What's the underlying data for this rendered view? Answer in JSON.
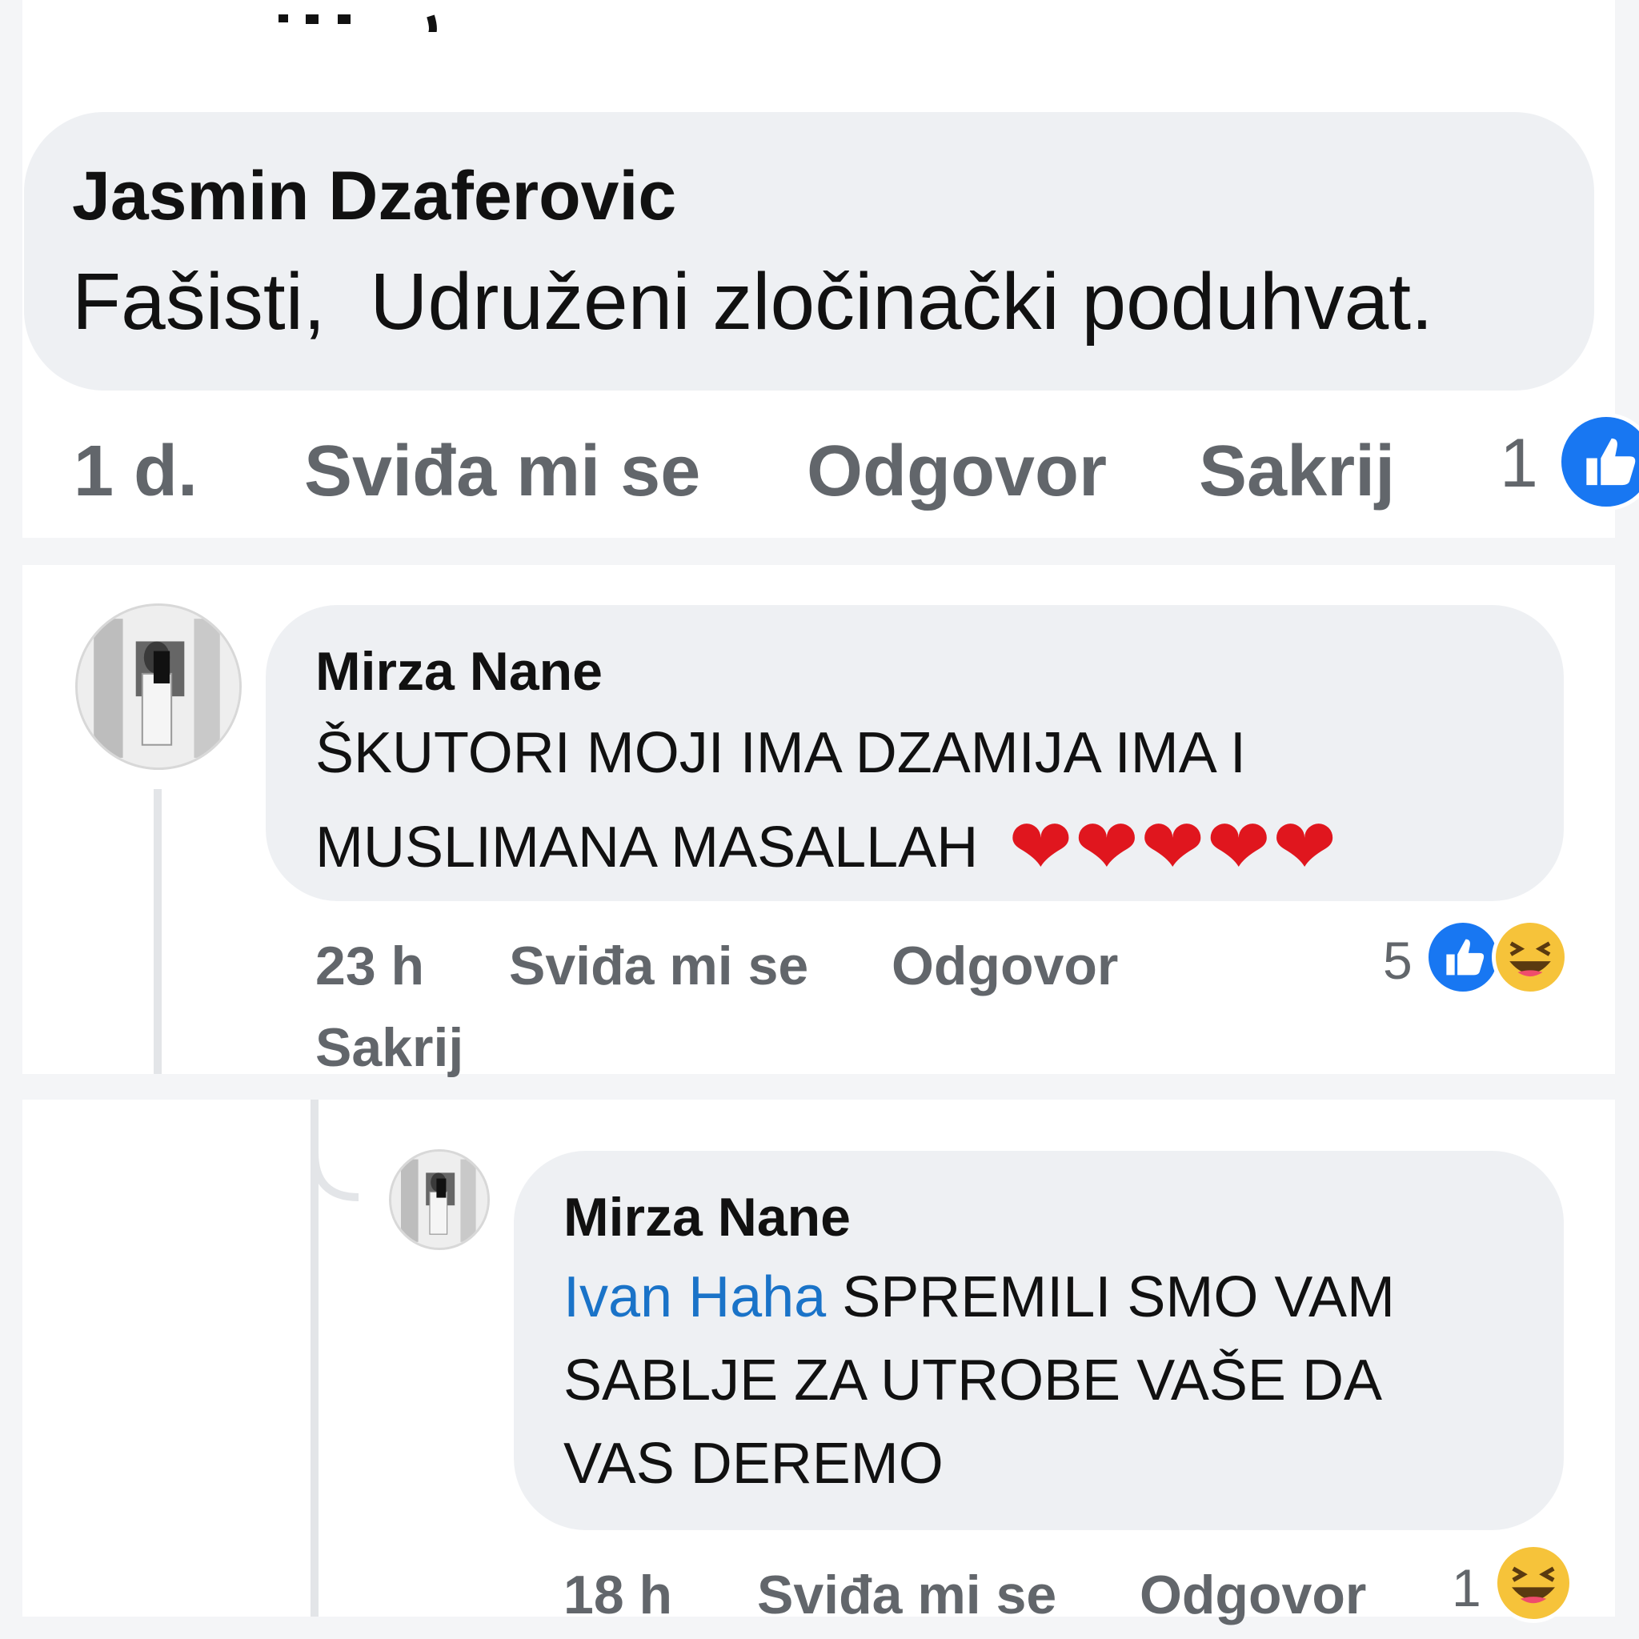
{
  "colors": {
    "page_bg": "#f4f5f7",
    "panel_bg": "#ffffff",
    "bubble_bg": "#eef0f3",
    "meta_text": "#62666b",
    "mention": "#1a73c8",
    "like_blue": "#1877f2",
    "haha_yellow": "#f6c33a",
    "heart_red": "#e0161e"
  },
  "comment1": {
    "author": "Jasmin Dzaferovic",
    "text": "Fašisti,  Udruženi zločinački poduhvat.",
    "time": "1 d.",
    "like_label": "Sviđa mi se",
    "reply_label": "Odgovor",
    "hide_label": "Sakrij",
    "reaction_count": "1",
    "reactions": [
      "like-icon"
    ]
  },
  "comment2": {
    "author": "Mirza Nane",
    "text_line1": "ŠKUTORI MOJI IMA DZAMIJA IMA I",
    "text_line2": "MUSLIMANA MASALLAH",
    "emoji_hearts": "❤❤❤❤❤",
    "time": "23 h",
    "like_label": "Sviđa mi se",
    "reply_label": "Odgovor",
    "hide_label": "Sakrij",
    "reaction_count": "5",
    "reactions": [
      "like-icon",
      "haha-icon"
    ]
  },
  "comment3": {
    "author": "Mirza Nane",
    "mention": "Ivan Haha",
    "text_line1": " SPREMILI SMO VAM",
    "text_line2": "SABLJE ZA UTROBE VAŠE DA",
    "text_line3": "VAS DEREMO",
    "time": "18 h",
    "like_label": "Sviđa mi se",
    "reply_label": "Odgovor",
    "reaction_count": "1",
    "reactions": [
      "haha-icon"
    ]
  }
}
